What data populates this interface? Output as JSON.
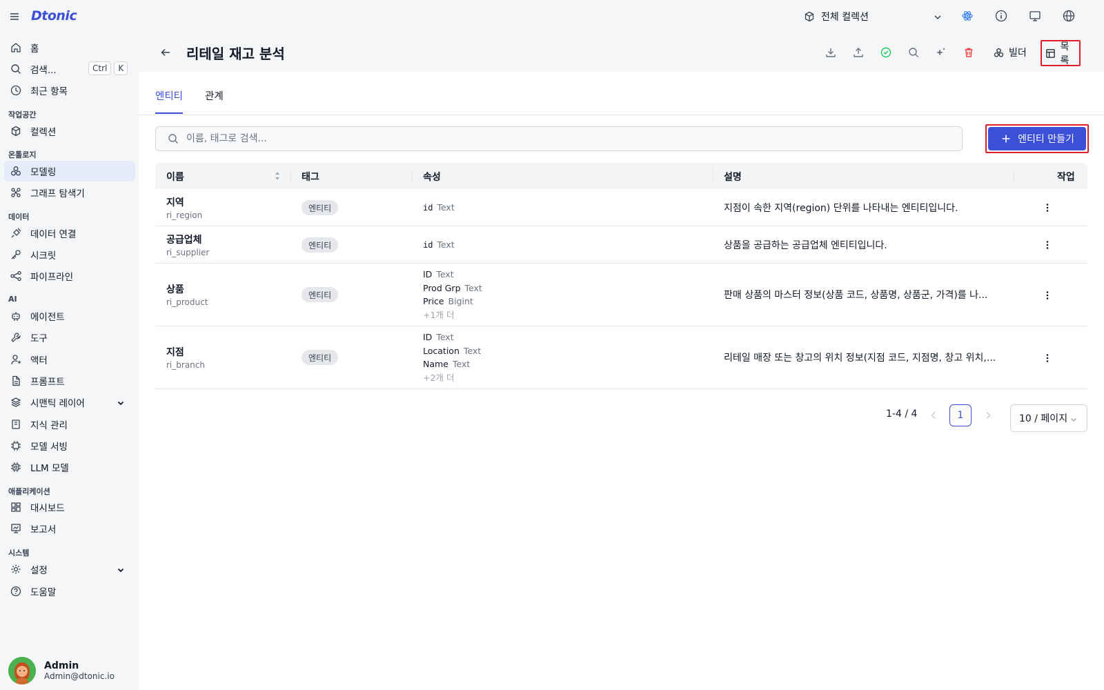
{
  "app": {
    "logo": "Dtonic"
  },
  "topbar": {
    "collection": "전체 컬렉션"
  },
  "sidebar": {
    "home": "홈",
    "search": "검색...",
    "shortcut": [
      "Ctrl",
      "K"
    ],
    "recent": "최근 항목",
    "sections": {
      "workspace": "작업공간",
      "ontology": "온톨로지",
      "data": "데이터",
      "ai": "AI",
      "apps": "애플리케이션",
      "system": "시스템"
    },
    "items": {
      "collection": "컬렉션",
      "modeling": "모델링",
      "graph": "그래프 탐색기",
      "data_conn": "데이터 연결",
      "secret": "시크릿",
      "pipeline": "파이프라인",
      "agent": "에이전트",
      "tool": "도구",
      "actor": "액터",
      "prompt": "프롬프트",
      "semantic": "시맨틱 레이어",
      "knowledge": "지식 관리",
      "serving": "모델 서빙",
      "llm": "LLM 모델",
      "dashboard": "대시보드",
      "report": "보고서",
      "settings": "설정",
      "help": "도움말"
    },
    "user": {
      "name": "Admin",
      "email": "Admin@dtonic.io"
    }
  },
  "header": {
    "title": "리테일 재고 분석",
    "builder": "빌더",
    "list": "목록"
  },
  "tabs": [
    "엔티티",
    "관계"
  ],
  "search": {
    "placeholder": "이름, 태그로 검색..."
  },
  "create_button": "엔티티 만들기",
  "table": {
    "columns": {
      "name": "이름",
      "tag": "태그",
      "attrs": "속성",
      "desc": "설명",
      "actions": "작업"
    },
    "rows": [
      {
        "name": "지역",
        "code": "ri_region",
        "tag": "엔티티",
        "attrs": [
          {
            "k": "id",
            "t": "Text"
          }
        ],
        "more": "",
        "desc": "지점이 속한 지역(region) 단위를 나타내는 엔티티입니다."
      },
      {
        "name": "공급업체",
        "code": "ri_supplier",
        "tag": "엔티티",
        "attrs": [
          {
            "k": "id",
            "t": "Text"
          }
        ],
        "more": "",
        "desc": "상품을 공급하는 공급업체 엔티티입니다."
      },
      {
        "name": "상품",
        "code": "ri_product",
        "tag": "엔티티",
        "attrs": [
          {
            "k": "ID",
            "t": "Text"
          },
          {
            "k": "Prod Grp",
            "t": "Text"
          },
          {
            "k": "Price",
            "t": "Bigint"
          }
        ],
        "more": "+1개 더",
        "desc": "판매 상품의 마스터 정보(상품 코드, 상품명, 상품군, 가격)를 나..."
      },
      {
        "name": "지점",
        "code": "ri_branch",
        "tag": "엔티티",
        "attrs": [
          {
            "k": "ID",
            "t": "Text"
          },
          {
            "k": "Location",
            "t": "Text"
          },
          {
            "k": "Name",
            "t": "Text"
          }
        ],
        "more": "+2개 더",
        "desc": "리테일 매장 또는 창고의 위치 정보(지점 코드, 지점명, 창고 위치,..."
      }
    ]
  },
  "pagination": {
    "range": "1-4 / 4",
    "page": "1",
    "page_size": "10 / 페이지"
  },
  "colors": {
    "accent": "#3b4fd8",
    "highlight": "#e11d2a",
    "success": "#22c55e",
    "danger": "#ef4444"
  }
}
